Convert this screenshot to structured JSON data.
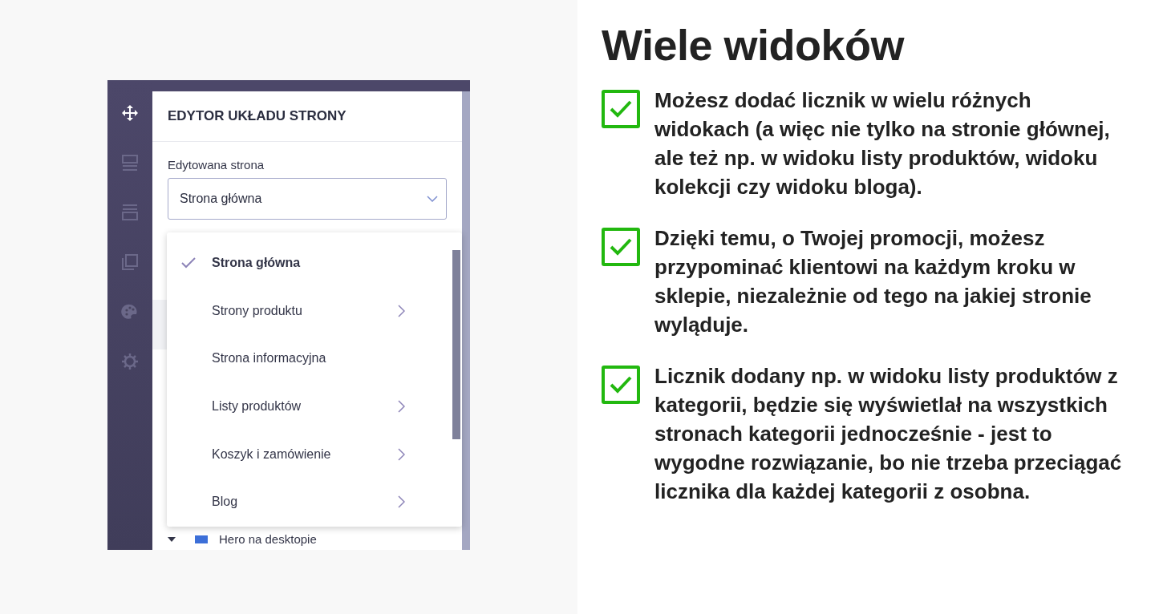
{
  "editor": {
    "sidebar": [
      {
        "kind": "move",
        "selected": true
      },
      {
        "kind": "layout",
        "selected": false
      },
      {
        "kind": "sections",
        "selected": false
      },
      {
        "kind": "pages",
        "selected": false
      },
      {
        "kind": "palette",
        "selected": false
      },
      {
        "kind": "settings",
        "selected": false
      }
    ],
    "title": "EDYTOR UKŁADU STRONY",
    "field_label": "Edytowana strona",
    "select_value": "Strona główna",
    "menu": [
      {
        "label": "Strona główna",
        "selected": true,
        "has_submenu": false
      },
      {
        "label": "Strony produktu",
        "selected": false,
        "has_submenu": true
      },
      {
        "label": "Strona informacyjna",
        "selected": false,
        "has_submenu": false
      },
      {
        "label": "Listy produktów",
        "selected": false,
        "has_submenu": true
      },
      {
        "label": "Koszyk i zamówienie",
        "selected": false,
        "has_submenu": true
      },
      {
        "label": "Blog",
        "selected": false,
        "has_submenu": true
      }
    ],
    "tree_row": "Hero na desktopie"
  },
  "heading": "Wiele widoków",
  "features": [
    {
      "checked": true,
      "text": "Możesz dodać licznik w wielu różnych widokach (a więc nie tylko na stronie głównej, ale też np. w widoku listy produktów, widoku kolekcji czy widoku bloga)."
    },
    {
      "checked": true,
      "text": "Dzięki temu, o Twojej promocji, możesz przypominać klientowi na każdym kroku w sklepie, niezależnie od tego na jakiej stronie wyląduje."
    },
    {
      "checked": true,
      "text": "Licznik dodany np. w widoku listy produktów z kategorii, będzie się wyświetlał na wszystkich stronach kategorii jednocześnie - jest to wygodne rozwiązanie, bo nie trzeba przeciągać licznika dla każdej kategorii z osobna."
    }
  ]
}
